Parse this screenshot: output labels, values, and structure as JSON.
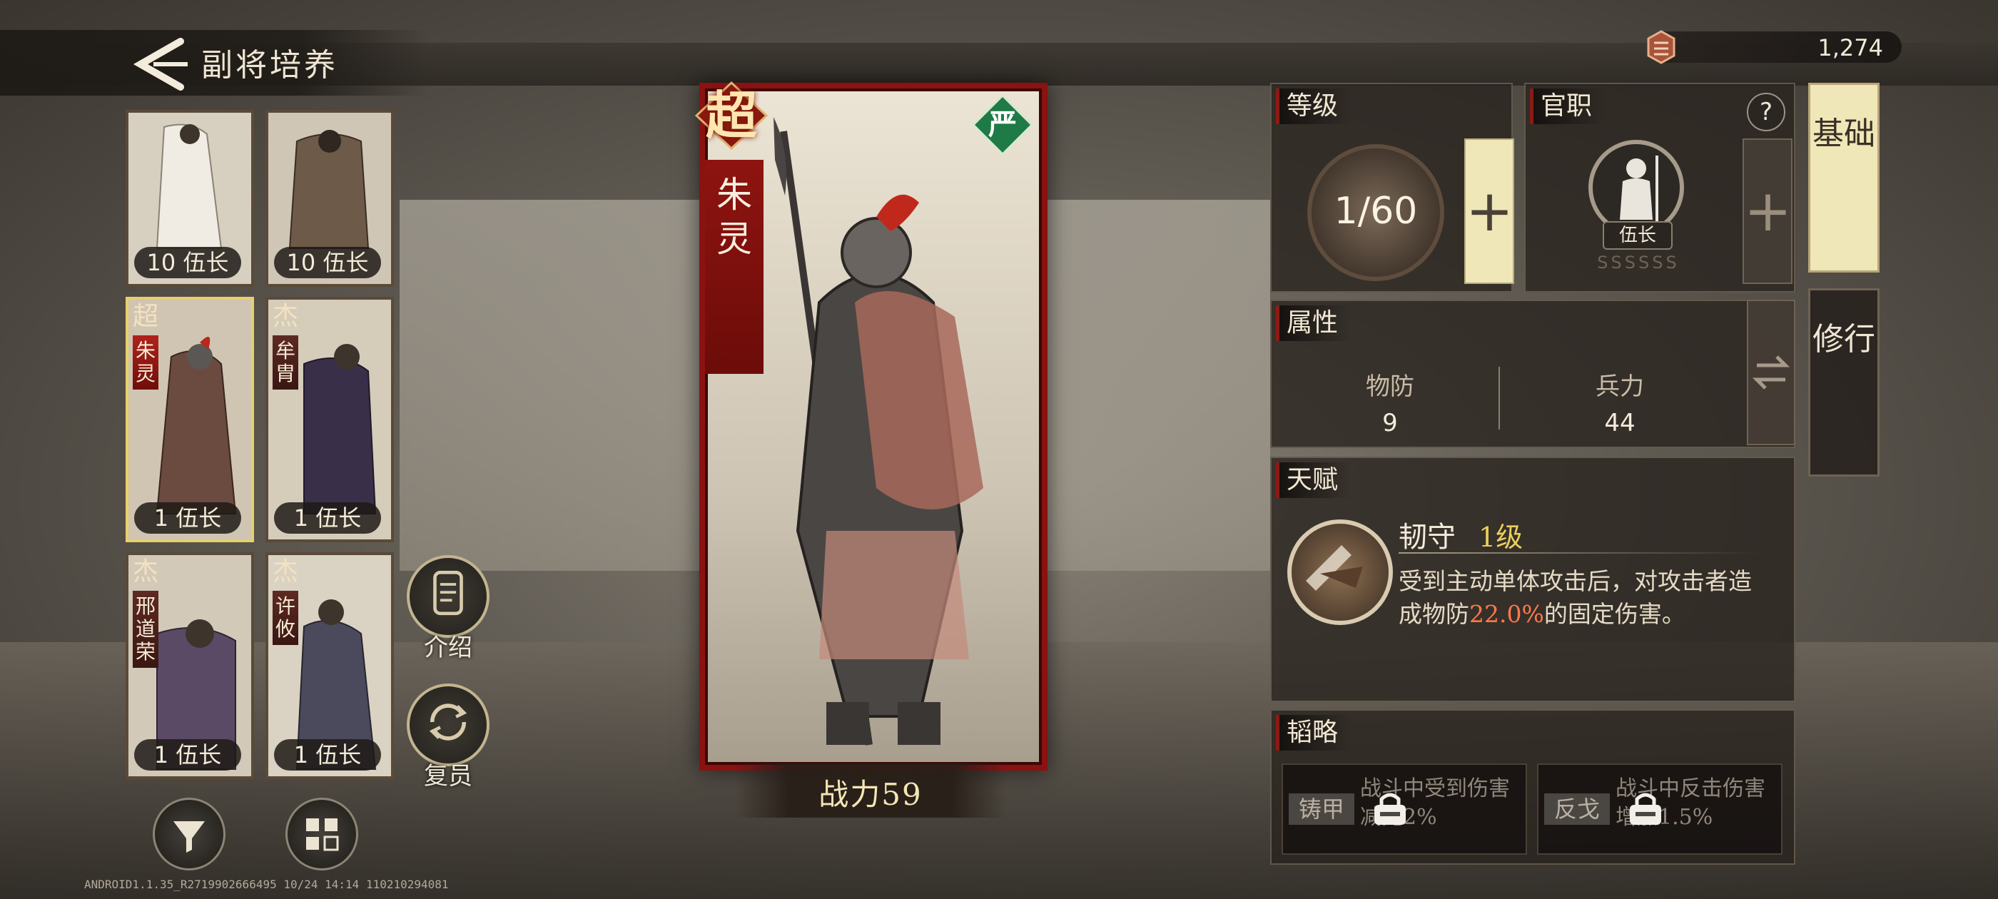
{
  "header": {
    "title": "副将培养",
    "currency_value": "1,274"
  },
  "hero_list": [
    {
      "name": "",
      "tier": "",
      "level_label": "10 伍长",
      "selected": false
    },
    {
      "name": "",
      "tier": "",
      "level_label": "10 伍长",
      "selected": false
    },
    {
      "name": "朱灵",
      "tier": "超",
      "level_label": "1 伍长",
      "selected": true
    },
    {
      "name": "牟胄",
      "tier": "杰",
      "level_label": "1 伍长",
      "selected": false
    },
    {
      "name": "邢道荣",
      "tier": "杰",
      "level_label": "1 伍长",
      "selected": false
    },
    {
      "name": "许攸",
      "tier": "杰",
      "level_label": "1 伍长",
      "selected": false
    }
  ],
  "side_buttons": {
    "intro": "介绍",
    "reset": "复员"
  },
  "hero": {
    "name": "朱灵",
    "tier": "超",
    "badge": "严",
    "power": "战力59"
  },
  "level_panel": {
    "title": "等级",
    "level": "1/60"
  },
  "rank_panel": {
    "title": "官职",
    "help": "?",
    "rank": "伍长",
    "stars": "SSSSSS"
  },
  "tabs": {
    "basic": "基础",
    "training": "修行"
  },
  "attr_panel": {
    "title": "属性",
    "stats": [
      {
        "name": "物防",
        "value": "9"
      },
      {
        "name": "兵力",
        "value": "44"
      }
    ]
  },
  "talent_panel": {
    "title": "天赋",
    "name": "韧守",
    "level": "1级",
    "desc_before": "受到主动单体攻击后，对攻击者造成物防",
    "desc_highlight": "22.0%",
    "desc_after": "的固定伤害。"
  },
  "strategy_panel": {
    "title": "韬略",
    "slots": [
      {
        "name": "铸甲",
        "desc": "战斗中受到伤害减免2%"
      },
      {
        "name": "反戈",
        "desc": "战斗中反击伤害增加1.5%"
      }
    ]
  },
  "footer": {
    "version": "ANDROID1.1.35_R2719902666495 10/24 14:14 110210294081"
  },
  "colors": {
    "accent_red": "#8a1210",
    "talent_highlight": "#ff7a4a",
    "talent_level": "#e8cf5c",
    "active_tab": "#efe7b8"
  }
}
